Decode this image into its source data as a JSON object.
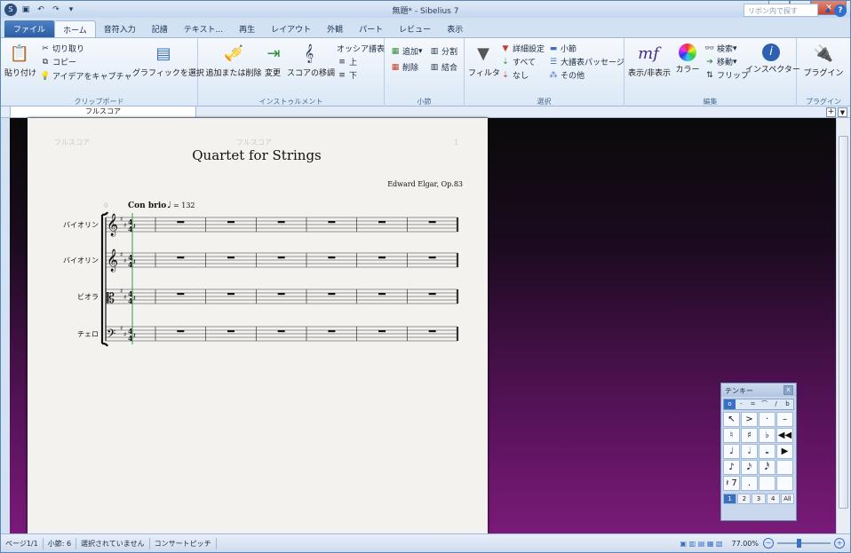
{
  "titlebar": {
    "title": "無題* - Sibelius 7",
    "app_icon": "S",
    "quick_access": [
      "save-icon",
      "undo-icon",
      "redo-icon",
      "dropdown-icon"
    ]
  },
  "tabs": [
    "ファイル",
    "ホーム",
    "音符入力",
    "記譜",
    "テキスト...",
    "再生",
    "レイアウト",
    "外観",
    "パート",
    "レビュー",
    "表示"
  ],
  "active_tab": "ホーム",
  "search": {
    "placeholder": "リボン内で探す"
  },
  "ribbon": {
    "clipboard": {
      "label": "クリップボード",
      "paste": "貼り付け",
      "cut": "切り取り",
      "copy": "コピー",
      "capture": "アイデアをキャプチャ",
      "select_graphic": "グラフィックを選択"
    },
    "instruments": {
      "label": "インストゥルメント",
      "add_remove": "追加または削除",
      "change": "変更",
      "transpose": "スコアの移調",
      "ossia": "オッシア譜表",
      "up": "上",
      "down": "下"
    },
    "bars": {
      "label": "小節",
      "add": "追加",
      "delete": "削除",
      "split": "分割",
      "join": "結合"
    },
    "select": {
      "label": "選択",
      "filter": "フィルタ",
      "advanced": "詳細設定",
      "all": "すべて",
      "none": "なし",
      "bar": "小節",
      "system_passage": "大譜表パッセージ",
      "other": "その他"
    },
    "edit": {
      "label": "編集",
      "show_hide": "表示/非表示",
      "color": "カラー",
      "find": "検索",
      "goto": "移動",
      "flip": "フリップ",
      "inspector": "インスペクター"
    },
    "plugins": {
      "label": "プラグイン",
      "plugins": "プラグイン"
    }
  },
  "doc_tabs": {
    "full_score": "フルスコア"
  },
  "score": {
    "header_left": "フルスコア",
    "header_center": "フルスコア",
    "page_number": "1",
    "title": "Quartet for Strings",
    "composer": "Edward Elgar, Op.83",
    "tempo_text": "Con brio",
    "tempo_value": "= 132",
    "bar_number": "0",
    "instruments": [
      "バイオリン",
      "バイオリン",
      "ビオラ",
      "チェロ"
    ],
    "clefs": [
      "treble",
      "treble",
      "alto",
      "bass"
    ],
    "key_sharps": 2,
    "time_signature": "4/4",
    "bars_per_system": 6
  },
  "keypad": {
    "title": "テンキー",
    "tabs": [
      "o",
      "-",
      "=",
      "⌒",
      "/",
      "b"
    ],
    "keys": [
      "↖",
      ">",
      "·",
      "–",
      "♮",
      "♯",
      "♭",
      "◀◀",
      "♩",
      "𝅗𝅥",
      "𝅝",
      "▶",
      "♪",
      "𝅘𝅥𝅯",
      "𝅘𝅥𝅰",
      "",
      "𝄽 7",
      ".",
      "",
      ""
    ],
    "sets": [
      "1",
      "2",
      "3",
      "4",
      "All"
    ],
    "active_set": "1"
  },
  "statusbar": {
    "page": "ページ1/1",
    "bars": "小節: 6",
    "selection": "選択されていません",
    "pitch": "コンサートピッチ",
    "zoom": "77.00%"
  }
}
